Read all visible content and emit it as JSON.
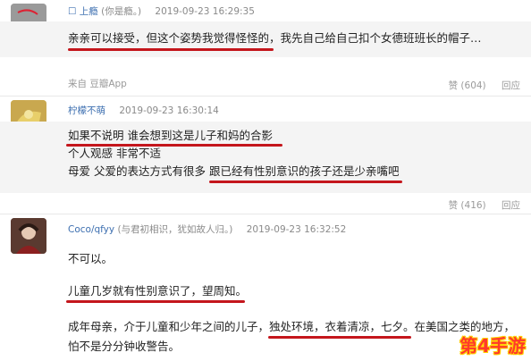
{
  "comments": [
    {
      "meta_prefix": "☐ 上瘾",
      "username": "(你是瘾。)",
      "time": "2019-09-23 16:29:35",
      "line1": "亲亲可以接受，但这个姿势我觉得怪怪的，我先自己给自己扣个女德班班长的帽子…",
      "source": "来自 豆瓣App",
      "likes": "赞 (604)",
      "reply": "回应"
    },
    {
      "username": "柠檬不萌",
      "time": "2019-09-23 16:30:14",
      "line1": "如果不说明 谁会想到这是儿子和妈的合影",
      "line2": "个人观感 非常不适",
      "line3a": "母爱 父爱的表达方式有很多 ",
      "line3b": "跟已经有性别意识的孩子还是少亲嘴吧",
      "likes": "赞 (416)",
      "reply": "回应"
    },
    {
      "username": "Coco/qfyy",
      "username_note": "(与君初相识，犹如故人归。)",
      "time": "2019-09-23 16:32:52",
      "line1": "不可以。",
      "line2": "儿童几岁就有性别意识了，望周知。",
      "line3": "成年母亲，介于儿童和少年之间的儿子，独处环境，衣着清凉，七夕。在美国之类的地方，",
      "line4": "怕不是分分钟收警告。"
    }
  ],
  "watermark": "第4手游",
  "colors": {
    "underline": "#c4161c",
    "username": "#3d6fb0",
    "meta": "#8a8a8a"
  }
}
